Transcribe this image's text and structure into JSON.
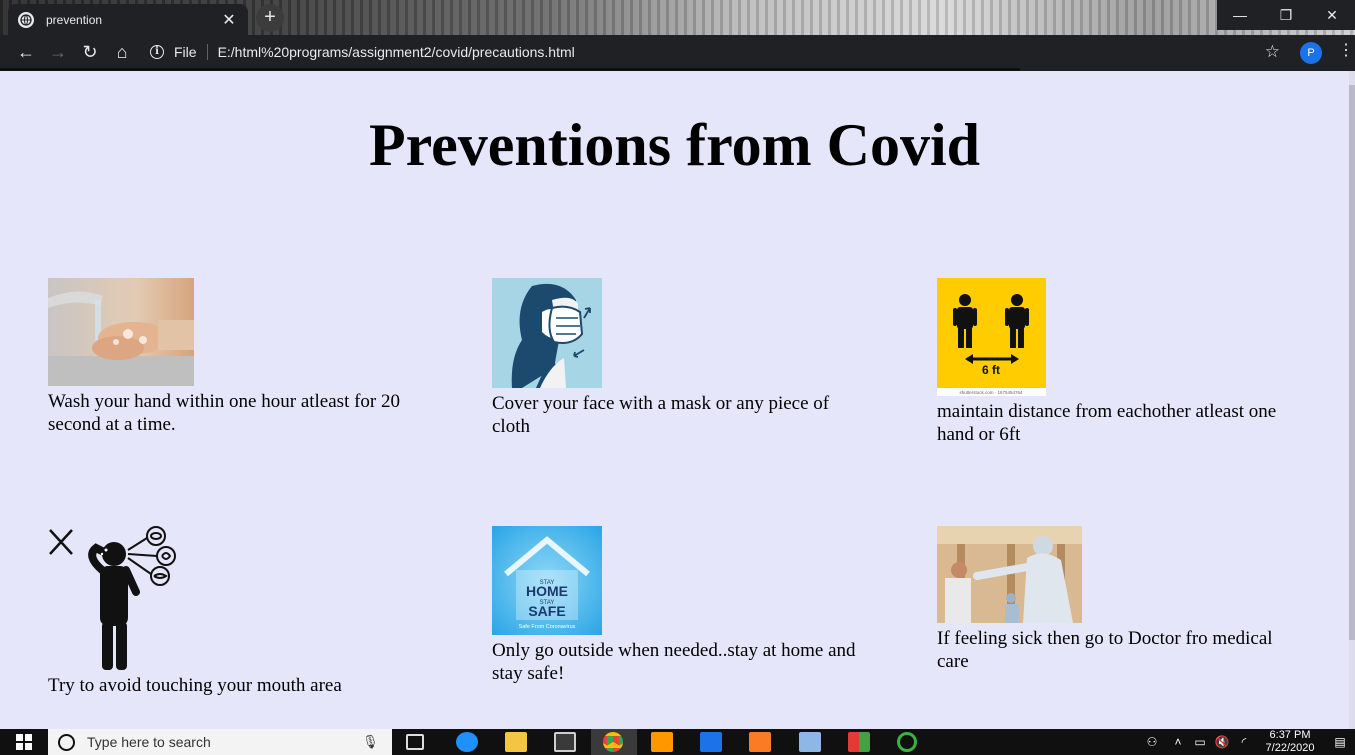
{
  "browser": {
    "tab_title": "prevention",
    "tab_close": "✕",
    "new_tab": "+",
    "window_controls": [
      "—",
      "❐",
      "✕"
    ],
    "nav": [
      "←",
      "→",
      "↻",
      "⌂"
    ],
    "file_label": "File",
    "url": "E:/html%20programs/assignment2/covid/precautions.html",
    "profile_initial": "P",
    "menu": "⋮"
  },
  "page": {
    "title": "Preventions from Covid",
    "items": [
      {
        "caption": "Wash your hand within one hour atleast for 20 second at a time.",
        "icon": "handwashing-image"
      },
      {
        "caption": "Cover your face with a mask or any piece of cloth",
        "icon": "mask-image"
      },
      {
        "caption": "maintain distance from eachother atleast one hand or 6ft",
        "icon": "social-distance-image",
        "sign_text": "6 ft",
        "watermark": "shutterstock.com · 1675454764"
      },
      {
        "caption": "Try to avoid touching your mouth area",
        "icon": "no-touching-face-image"
      },
      {
        "caption": "Only go outside when needed..stay at home and stay safe!",
        "icon": "stay-home-image",
        "sign_lines": [
          "STAY",
          "HOME",
          "STAY",
          "SAFE"
        ],
        "sign_footer": "Safe From Coronavirus"
      },
      {
        "caption": "If feeling sick then go to Doctor fro medical care",
        "icon": "doctor-image"
      }
    ]
  },
  "taskbar": {
    "search_placeholder": "Type here to search",
    "time": "6:37 PM",
    "date": "7/22/2020"
  }
}
